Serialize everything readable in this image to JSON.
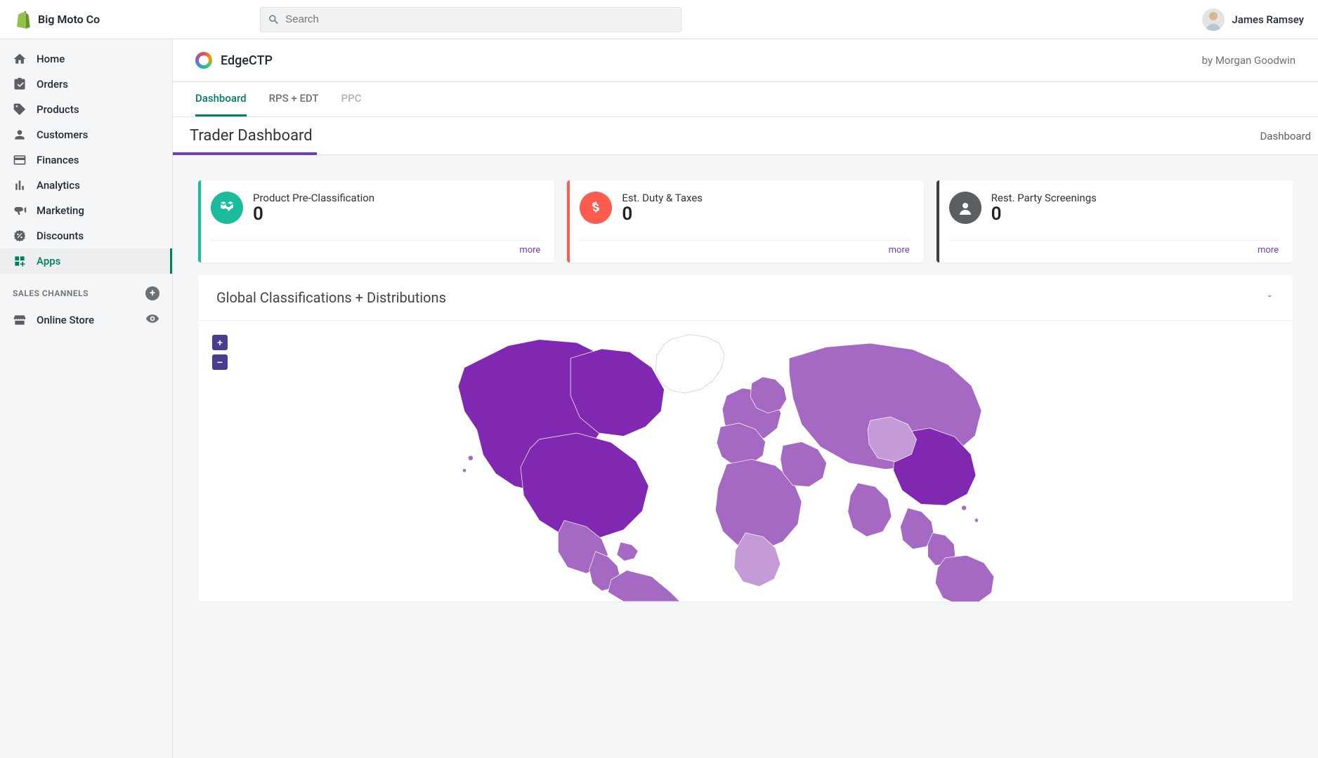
{
  "header": {
    "brand": "Big Moto Co",
    "search_placeholder": "Search",
    "user_name": "James Ramsey"
  },
  "sidebar": {
    "items": [
      {
        "label": "Home"
      },
      {
        "label": "Orders"
      },
      {
        "label": "Products"
      },
      {
        "label": "Customers"
      },
      {
        "label": "Finances"
      },
      {
        "label": "Analytics"
      },
      {
        "label": "Marketing"
      },
      {
        "label": "Discounts"
      },
      {
        "label": "Apps"
      }
    ],
    "section_label": "SALES CHANNELS",
    "online_store": "Online Store"
  },
  "app": {
    "name": "EdgeCTP",
    "author_prefix": "by ",
    "author": "Morgan Goodwin"
  },
  "tabs": [
    {
      "label": "Dashboard",
      "active": true
    },
    {
      "label": "RPS + EDT"
    },
    {
      "label": "PPC",
      "muted": true
    }
  ],
  "subheader": {
    "title": "Trader Dashboard",
    "breadcrumb": "Dashboard"
  },
  "cards": [
    {
      "title": "Product Pre-Classification",
      "value": "0",
      "more": "more",
      "color": "teal"
    },
    {
      "title": "Est. Duty & Taxes",
      "value": "0",
      "more": "more",
      "color": "red"
    },
    {
      "title": "Rest. Party Screenings",
      "value": "0",
      "more": "more",
      "color": "dark"
    }
  ],
  "map": {
    "title": "Global Classifications + Distributions",
    "zoom_in": "+",
    "zoom_out": "−"
  }
}
